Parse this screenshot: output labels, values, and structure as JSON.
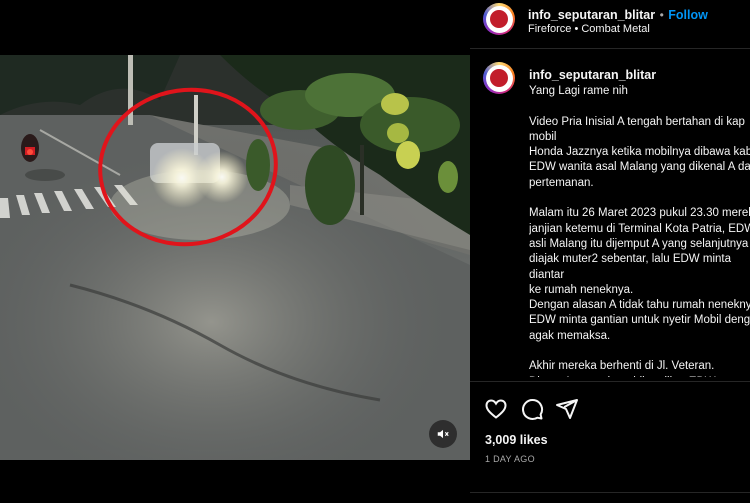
{
  "post": {
    "username": "info_seputaran_blitar",
    "separator": "•",
    "follow_label": "Follow",
    "audio": "Fireforce • Combat Metal"
  },
  "caption": {
    "username": "info_seputaran_blitar",
    "text": "Yang Lagi rame nih\n\nVideo Pria Inisial A tengah bertahan di kap mobil\nHonda Jazznya ketika mobilnya dibawa kabur\nEDW wanita asal Malang yang dikenal A dari\npertemanan.\n\nMalam itu 26 Maret 2023 pukul 23.30 mereka\njanjian ketemu di Terminal Kota Patria, EDW\nasli Malang itu dijemput A yang selanjutnya\ndiajak muter2 sebentar, lalu EDW minta diantar\nke rumah neneknya.\nDengan alasan A tidak tahu rumah neneknya,\nEDW minta gantian untuk nyetir Mobil dengan\nagak memaksa.\n\nAkhir mereka berhenti di Jl. Veteran.\nDisaat A turun dr mobil, terlihat EDW memacu\nmobil dan A lagi kembali ke arah pintu"
  },
  "actions": {
    "likes": "3,009 likes",
    "time": "1 DAY AGO"
  },
  "icons": {
    "like": "heart-icon",
    "comment": "comment-icon",
    "share": "share-icon",
    "mute": "speaker-muted-icon"
  },
  "colors": {
    "follow": "#0095f6",
    "highlight_circle": "#e0141b"
  }
}
